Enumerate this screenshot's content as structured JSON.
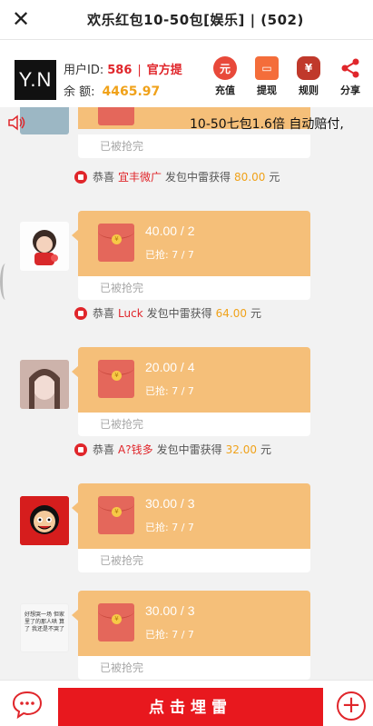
{
  "titlebar": {
    "title": "欢乐红包10-50包[娱乐] | (502)"
  },
  "user": {
    "avatar_text": "Y.N",
    "id_label": "用户ID:",
    "id_value": "586",
    "official": "官方提",
    "balance_label": "余  额:",
    "balance_value": "4465.97"
  },
  "actions": [
    {
      "label": "充值",
      "icon": "recharge-icon"
    },
    {
      "label": "提现",
      "icon": "withdraw-icon"
    },
    {
      "label": "规则",
      "icon": "money-bag-icon"
    },
    {
      "label": "分享",
      "icon": "share-icon"
    }
  ],
  "marquee": {
    "text": "10-50七包1.6倍 自动赔付,"
  },
  "feed": {
    "first_partial": {
      "status": "已被抢完"
    },
    "notices": [
      {
        "pre": "恭喜",
        "who": "宜丰微广",
        "mid": "发包中雷获得",
        "amount": "80.00",
        "unit": "元"
      },
      {
        "pre": "恭喜",
        "who": "Luck",
        "mid": "发包中雷获得",
        "amount": "64.00",
        "unit": "元"
      },
      {
        "pre": "恭喜",
        "who": "A?钱多",
        "mid": "发包中雷获得",
        "amount": "32.00",
        "unit": "元"
      }
    ],
    "packets": [
      {
        "amount": "40.00 / 2",
        "grabbed": "已抢: 7 / 7",
        "status": "已被抢完"
      },
      {
        "amount": "20.00 / 4",
        "grabbed": "已抢: 7 / 7",
        "status": "已被抢完"
      },
      {
        "amount": "30.00 / 3",
        "grabbed": "已抢: 7 / 7",
        "status": "已被抢完"
      },
      {
        "amount": "30.00 / 3",
        "grabbed": "已抢: 7 / 7",
        "status": "已被抢完"
      }
    ],
    "meme_text": "好想哭一场 但家里了的那人哄 算了 我还是不哭了"
  },
  "bottom": {
    "bomb_label": "点击埋雷"
  },
  "colors": {
    "accent": "#e0262b",
    "packet": "#f5bf79",
    "envelope": "#e4675b",
    "gold": "#f0a21a"
  }
}
